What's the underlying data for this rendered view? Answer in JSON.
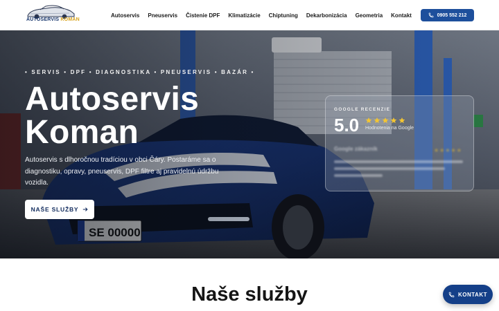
{
  "brand": {
    "logo_text_main": "AUTOSERVIS",
    "logo_text_accent": "KOMAN",
    "logo_icon": "car-logo-icon"
  },
  "nav": {
    "items": [
      {
        "label": "Autoservis"
      },
      {
        "label": "Pneuservis"
      },
      {
        "label": "Čistenie DPF"
      },
      {
        "label": "Klimatizácie"
      },
      {
        "label": "Chiptuning"
      },
      {
        "label": "Dekarbonizácia"
      },
      {
        "label": "Geometria"
      },
      {
        "label": "Kontakt"
      }
    ],
    "phone": "0905 552 212",
    "phone_icon": "phone-icon"
  },
  "hero": {
    "tagline": "• SERVIS • DPF • DIAGNOSTIKA • PNEUSERVIS • BAZÁR •",
    "title_line1": "Autoservis",
    "title_line2": "Koman",
    "description": "Autoservis s dlhoročnou tradíciou v obci Čáry. Postaráme sa o diagnostiku, opravy, pneuservis, DPF filtre aj pravidelnú údržbu vozidla.",
    "cta_label": "NAŠE SLUŽBY",
    "cta_icon": "arrow-right-icon"
  },
  "reviews": {
    "label": "GOOGLE RECENZIE",
    "score": "5.0",
    "stars": 5,
    "subtitle": "Hodnotenia na Google",
    "preview_name": "Google zákazník"
  },
  "services": {
    "title": "Naše služby"
  },
  "contact_fab": {
    "label": "KONTAKT",
    "icon": "phone-icon"
  },
  "colors": {
    "primary": "#1d4f9c",
    "primary_dark": "#143f88",
    "star": "#f3c533",
    "logo_accent": "#d8a21a"
  }
}
